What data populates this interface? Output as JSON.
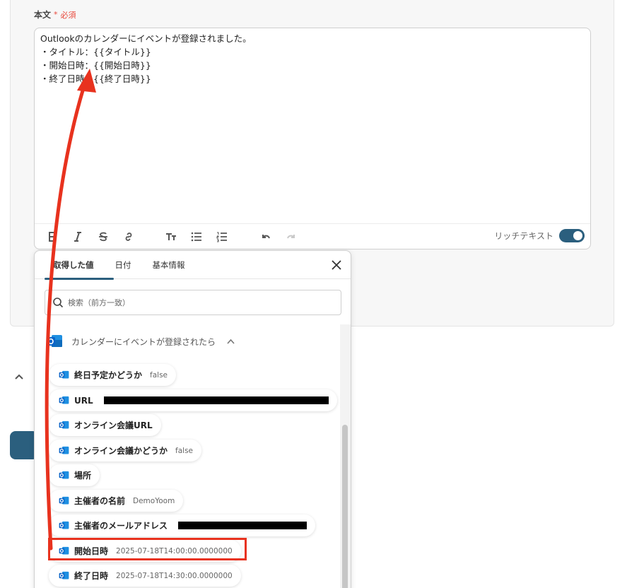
{
  "field": {
    "label": "本文",
    "required_mark": "*",
    "required_text": "必須"
  },
  "editor": {
    "content": "Outlookのカレンダーにイベントが登録されました。\n・タイトル：{{タイトル}}\n・開始日時：{{開始日時}}\n・終了日時：{{終了日時}}",
    "toolbar": {
      "rich_text_label": "リッチテキスト",
      "rich_text_enabled": true
    }
  },
  "popover": {
    "tabs": [
      {
        "label": "取得した値",
        "active": true
      },
      {
        "label": "日付",
        "active": false
      },
      {
        "label": "基本情報",
        "active": false
      }
    ],
    "search_placeholder": "検索（前方一致）",
    "group_title": "カレンダーにイベントが登録されたら",
    "items": [
      {
        "label": "終日予定かどうか",
        "value": "false"
      },
      {
        "label": "URL",
        "value": "",
        "redacted": true
      },
      {
        "label": "オンライン会議URL",
        "value": ""
      },
      {
        "label": "オンライン会議かどうか",
        "value": "false"
      },
      {
        "label": "場所",
        "value": ""
      },
      {
        "label": "主催者の名前",
        "value": "DemoYoom"
      },
      {
        "label": "主催者のメールアドレス",
        "value": "",
        "redacted": true
      },
      {
        "label": "開始日時",
        "value": "2025-07-18T14:00:00.0000000",
        "highlighted": true
      },
      {
        "label": "終了日時",
        "value": "2025-07-18T14:30:00.0000000"
      }
    ]
  },
  "colors": {
    "accent": "#2b5f7e",
    "required": "#e8483b",
    "highlight": "#e8321e",
    "outlook_blue": "#0a64c8"
  }
}
